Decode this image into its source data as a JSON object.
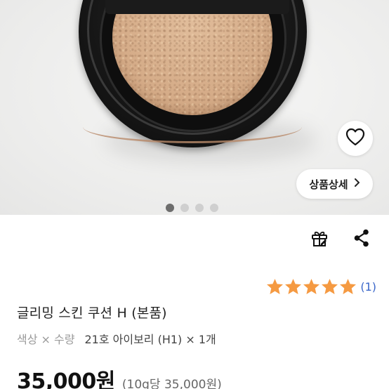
{
  "gallery": {
    "detail_button_label": "상품상세",
    "slide_count": 4,
    "active_slide": 1,
    "heart_icon": "heart-outline-icon",
    "chevron_icon": "chevron-right-icon"
  },
  "actions": {
    "gift_icon": "gift-icon",
    "share_icon": "share-icon"
  },
  "rating": {
    "stars": 5,
    "max_stars": 5,
    "count_label": "(1)",
    "star_color": "#f59a42"
  },
  "product": {
    "title": "글리밍 스킨 쿠션 H (본품)",
    "option_label": "색상 × 수량",
    "option_value": "21호 아이보리 (H1) × 1개",
    "price": "35,000원",
    "unit_price": "(10g당 35,000원)"
  }
}
